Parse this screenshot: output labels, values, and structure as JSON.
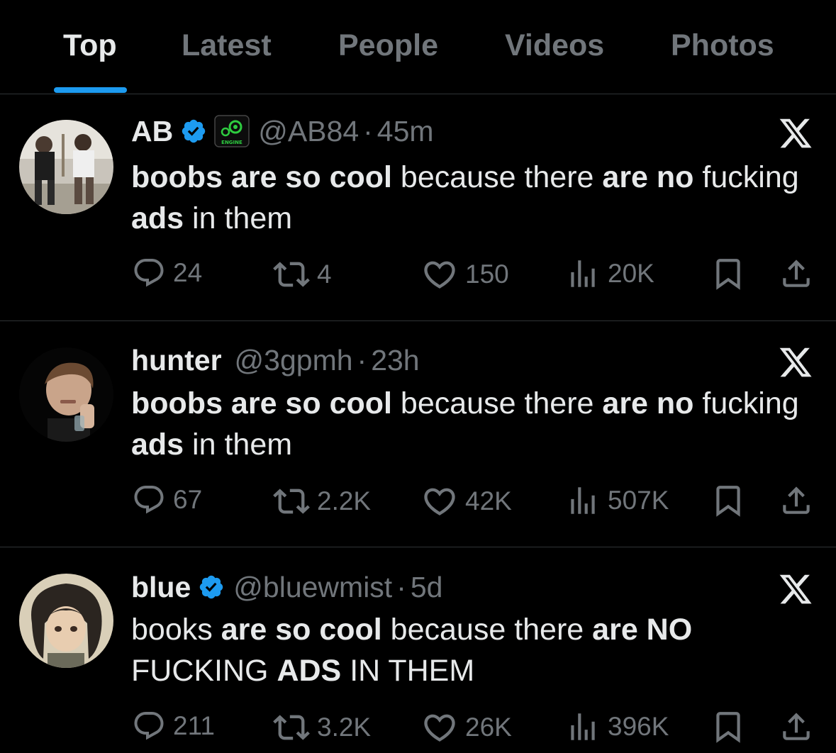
{
  "tabs": [
    {
      "label": "Top",
      "active": true
    },
    {
      "label": "Latest",
      "active": false
    },
    {
      "label": "People",
      "active": false
    },
    {
      "label": "Videos",
      "active": false
    },
    {
      "label": "Photos",
      "active": false
    }
  ],
  "colors": {
    "accent": "#1d9bf0",
    "muted": "#71767b",
    "text": "#e7e9ea",
    "divider": "#2f3336",
    "background": "#000000"
  },
  "tweets": [
    {
      "name": "AB",
      "verified": true,
      "affiliate_badge": "ENGINE",
      "handle": "@AB84",
      "time": "45m",
      "text": {
        "p1": "boobs are so cool",
        "p2": " because there ",
        "p3": "are no",
        "p4": " fucking ",
        "p5": "ads",
        "p6": " in them"
      },
      "replies": "24",
      "reposts": "4",
      "likes": "150",
      "views": "20K"
    },
    {
      "name": "hunter",
      "verified": false,
      "handle": "@3gpmh",
      "time": "23h",
      "text": {
        "p1": "boobs are so cool",
        "p2": " because there ",
        "p3": "are no",
        "p4": " fucking ",
        "p5": "ads",
        "p6": " in them"
      },
      "replies": "67",
      "reposts": "2.2K",
      "likes": "42K",
      "views": "507K"
    },
    {
      "name": "blue",
      "verified": true,
      "handle": "@bluewmist",
      "time": "5d",
      "text": {
        "p1": "books ",
        "p2": "are so cool",
        "p3": " because there ",
        "p4": "are NO",
        "p5": " FUCKING ",
        "p6": "ADS",
        "p7": " IN THEM"
      },
      "replies": "211",
      "reposts": "3.2K",
      "likes": "26K",
      "views": "396K"
    }
  ],
  "icons": [
    "reply-icon",
    "repost-icon",
    "like-icon",
    "views-icon",
    "bookmark-icon",
    "share-icon",
    "verified-icon",
    "x-logo-icon"
  ]
}
